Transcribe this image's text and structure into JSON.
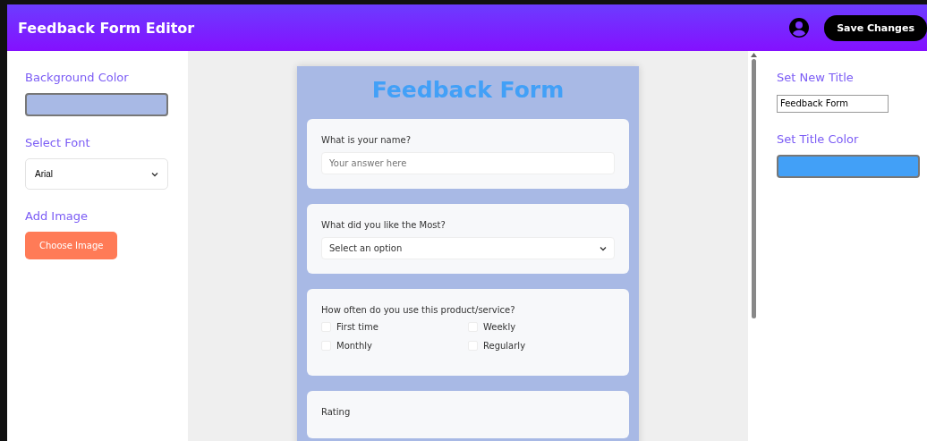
{
  "header": {
    "title": "Feedback Form Editor",
    "save_button": "Save Changes"
  },
  "left_panel": {
    "background_color": {
      "label": "Background Color",
      "color": "#a8b9e5"
    },
    "font": {
      "label": "Select Font",
      "value": "Arial"
    },
    "image": {
      "label": "Add Image",
      "button": "Choose Image"
    }
  },
  "form": {
    "title": "Feedback Form",
    "questions": [
      {
        "kind": "text",
        "label": "What is your name?",
        "placeholder": "Your answer here"
      },
      {
        "kind": "select",
        "label": "What did you like the Most?",
        "value": "Select an option"
      },
      {
        "kind": "checkboxes",
        "label": "How often do you use this product/service?",
        "options": [
          {
            "label": "First time",
            "checked": false
          },
          {
            "label": "Weekly",
            "checked": false
          },
          {
            "label": "Monthly",
            "checked": false
          },
          {
            "label": "Regularly",
            "checked": false
          }
        ]
      },
      {
        "kind": "rating",
        "label": "Rating"
      }
    ]
  },
  "right_panel": {
    "title": {
      "label": "Set New Title",
      "value": "Feedback Form"
    },
    "title_color": {
      "label": "Set Title Color",
      "color": "#42a0f7"
    }
  }
}
